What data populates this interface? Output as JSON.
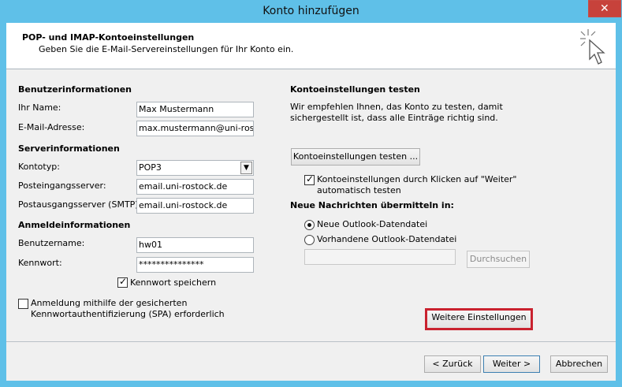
{
  "window": {
    "title": "Konto hinzufügen",
    "close_glyph": "✕"
  },
  "header": {
    "title": "POP- und IMAP-Kontoeinstellungen",
    "subtitle": "Geben Sie die E-Mail-Servereinstellungen für Ihr Konto ein.",
    "icon": "cursor-sparkle-icon"
  },
  "left": {
    "user_section": "Benutzerinformationen",
    "name_label": "Ihr Name:",
    "name_value": "Max Mustermann",
    "email_label": "E-Mail-Adresse:",
    "email_value": "max.mustermann@uni-rostc",
    "server_section": "Serverinformationen",
    "account_type_label": "Kontotyp:",
    "account_type_value": "POP3",
    "incoming_label": "Posteingangsserver:",
    "incoming_value": "email.uni-rostock.de",
    "outgoing_label": "Postausgangsserver (SMTP):",
    "outgoing_value": "email.uni-rostock.de",
    "login_section": "Anmeldeinformationen",
    "username_label": "Benutzername:",
    "username_value": "hw01",
    "password_label": "Kennwort:",
    "password_value": "***************",
    "save_password_label": "Kennwort speichern",
    "spa_label_line1": "Anmeldung mithilfe der gesicherten",
    "spa_label_line2": "Kennwortauthentifizierung (SPA) erforderlich"
  },
  "right": {
    "test_section": "Kontoeinstellungen testen",
    "test_desc_line1": "Wir empfehlen Ihnen, das Konto zu testen, damit",
    "test_desc_line2": "sichergestellt ist, dass alle Einträge richtig sind.",
    "test_button": "Kontoeinstellungen testen ...",
    "auto_test_line1": "Kontoeinstellungen durch Klicken auf \"Weiter\"",
    "auto_test_line2": "automatisch testen",
    "deliver_section": "Neue Nachrichten übermitteln in:",
    "radio_new": "Neue Outlook-Datendatei",
    "radio_existing": "Vorhandene Outlook-Datendatei",
    "browse_button": "Durchsuchen",
    "more_settings_button": "Weitere Einstellungen"
  },
  "footer": {
    "back_button": "< Zurück",
    "next_button": "Weiter >",
    "cancel_button": "Abbrechen"
  },
  "states": {
    "save_password_checked": true,
    "spa_checked": false,
    "auto_test_checked": true,
    "selected_radio": "radio_new"
  },
  "colors": {
    "highlight": "#c9222f",
    "titlebar": "#5fc0e8",
    "close": "#c7423b"
  }
}
